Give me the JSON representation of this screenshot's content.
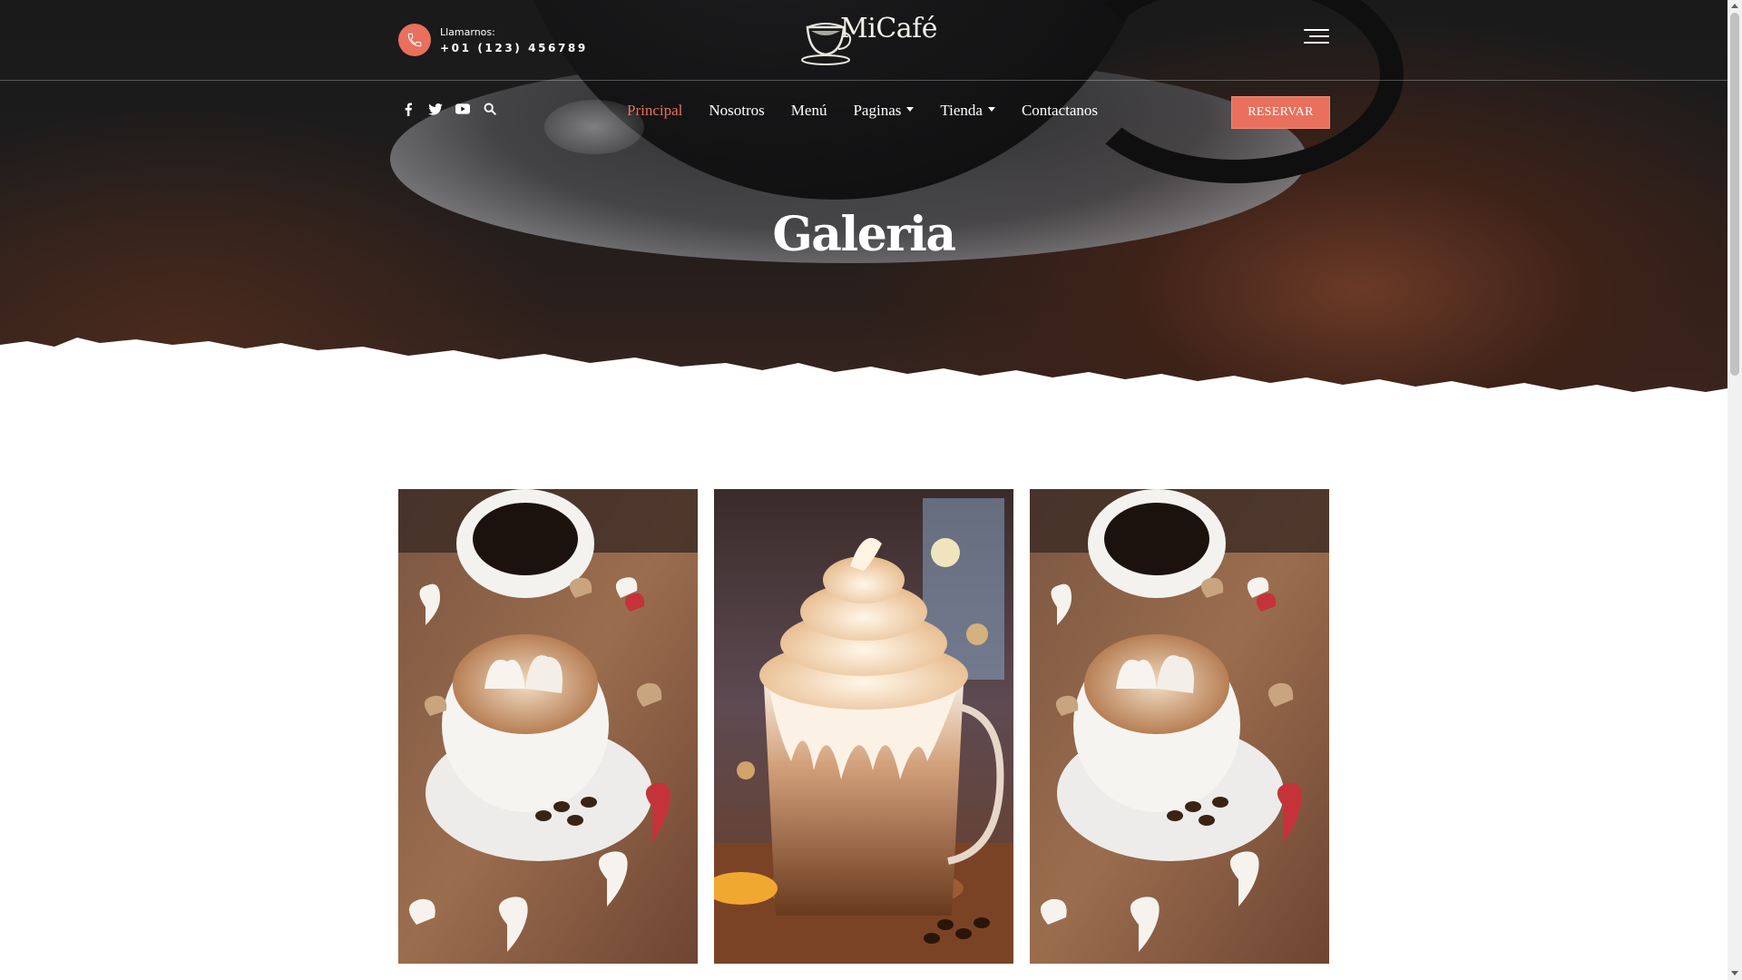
{
  "header": {
    "phone_label": "Llamarnos:",
    "phone_number": "+01 (123) 456789",
    "logo_text": "MiCafé"
  },
  "nav": {
    "items": [
      {
        "label": "Principal",
        "active": true,
        "dropdown": false
      },
      {
        "label": "Nosotros",
        "active": false,
        "dropdown": false
      },
      {
        "label": "Menú",
        "active": false,
        "dropdown": false
      },
      {
        "label": "Paginas",
        "active": false,
        "dropdown": true
      },
      {
        "label": "Tienda",
        "active": false,
        "dropdown": true
      },
      {
        "label": "Contactanos",
        "active": false,
        "dropdown": false
      }
    ],
    "reserve_label": "RESERVAR"
  },
  "social_icons": [
    "facebook-icon",
    "twitter-icon",
    "youtube-icon",
    "search-icon"
  ],
  "page_title": "Galeria",
  "gallery": {
    "images": [
      "latte-with-heart-marshmallows",
      "whipped-cream-mocha-mug",
      "latte-with-heart-marshmallows"
    ]
  },
  "colors": {
    "accent": "#e8705c",
    "hero_dark": "#1a1a1b",
    "text_light": "#ffffff"
  }
}
